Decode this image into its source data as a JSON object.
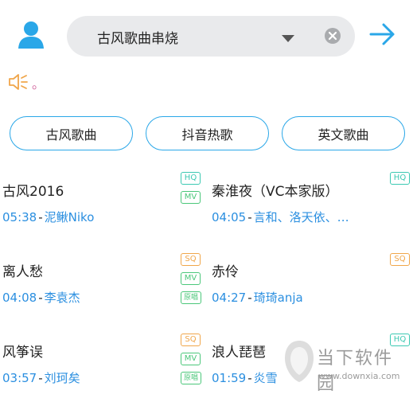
{
  "header": {
    "search_value": "古风歌曲串烧"
  },
  "notice": {
    "text": "。"
  },
  "tags": [
    {
      "label": "古风歌曲"
    },
    {
      "label": "抖音热歌"
    },
    {
      "label": "英文歌曲"
    }
  ],
  "songs": [
    {
      "title": "古风2016",
      "duration": "05:38",
      "artist": "泥鳅Niko",
      "badges": [
        "HQ",
        "MV"
      ]
    },
    {
      "title": "秦淮夜（VC本家版）",
      "duration": "04:05",
      "artist": "言和、洛天依、…",
      "badges": [
        "HQ"
      ]
    },
    {
      "title": "离人愁",
      "duration": "04:08",
      "artist": "李袁杰",
      "badges": [
        "SQ",
        "MV",
        "原唱"
      ]
    },
    {
      "title": "赤伶",
      "duration": "04:27",
      "artist": "琦琦anja",
      "badges": [
        "SQ"
      ]
    },
    {
      "title": "风筝误",
      "duration": "03:57",
      "artist": "刘珂矣",
      "badges": [
        "SQ",
        "MV",
        "原唱"
      ]
    },
    {
      "title": "浪人琵琶",
      "duration": "01:59",
      "artist": "炎雪",
      "badges": [
        "HQ"
      ]
    }
  ],
  "separator": "-",
  "watermark": {
    "text": "当下软件园",
    "url": "www.downxia.com"
  },
  "colors": {
    "accent": "#2aa7e8",
    "link": "#2b8fe0",
    "hq": "#3cc9b2",
    "mv": "#4bc77a",
    "sq": "#f0a64a",
    "notice": "#d36ba0"
  }
}
